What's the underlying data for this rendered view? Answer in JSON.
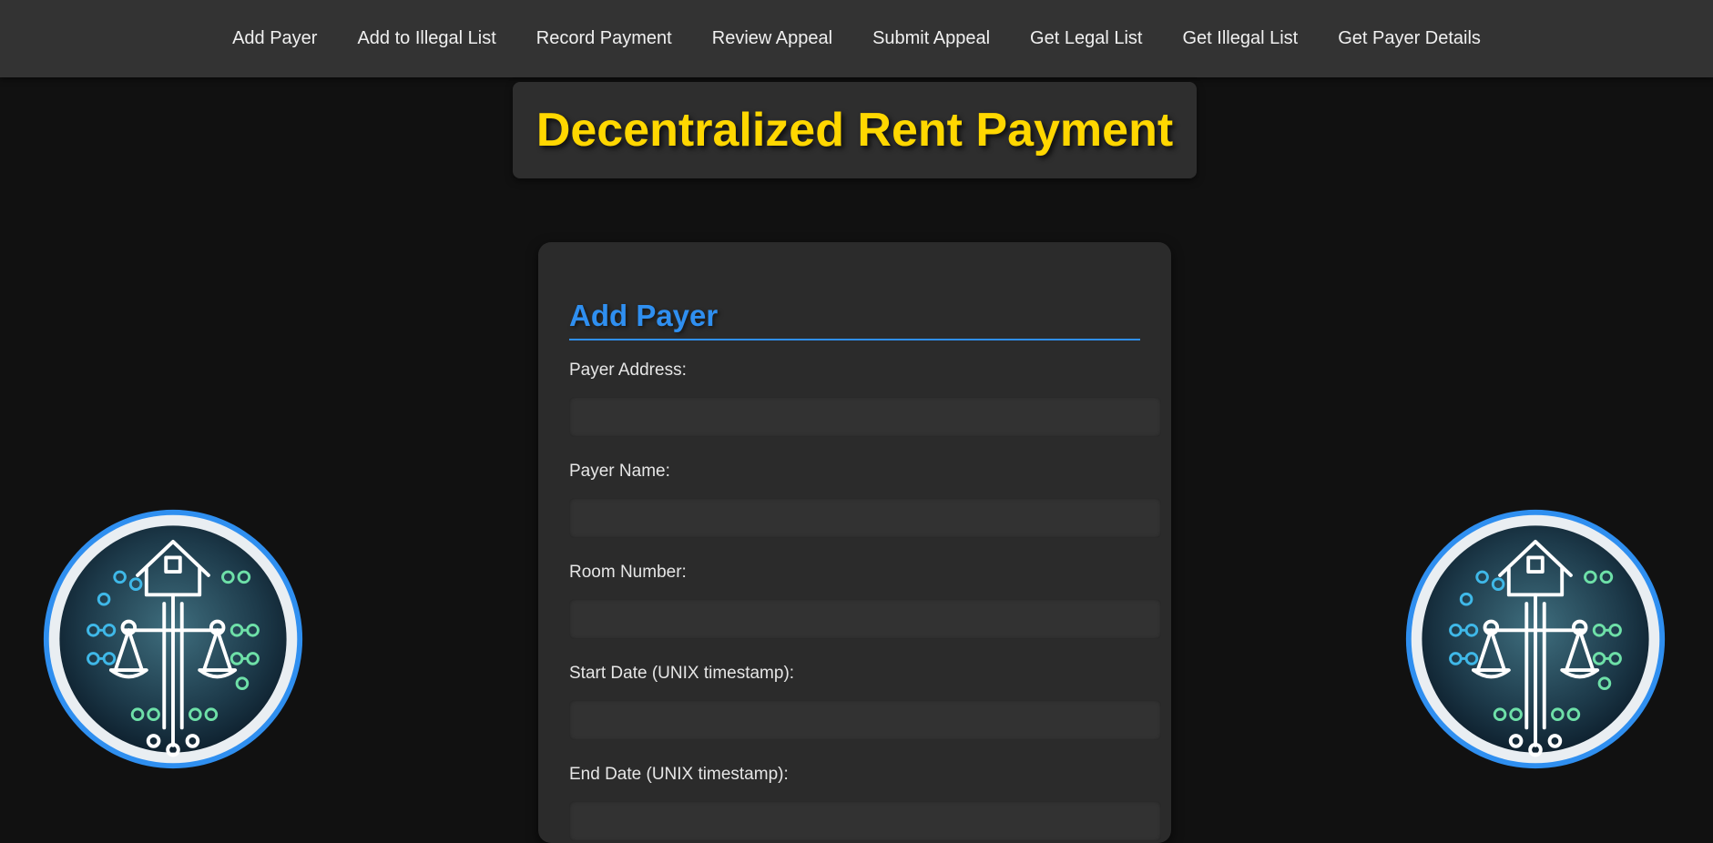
{
  "nav": {
    "items": [
      {
        "label": "Add Payer"
      },
      {
        "label": "Add to Illegal List"
      },
      {
        "label": "Record Payment"
      },
      {
        "label": "Review Appeal"
      },
      {
        "label": "Submit Appeal"
      },
      {
        "label": "Get Legal List"
      },
      {
        "label": "Get Illegal List"
      },
      {
        "label": "Get Payer Details"
      }
    ]
  },
  "header": {
    "title": "Decentralized Rent Payment"
  },
  "form": {
    "heading": "Add Payer",
    "fields": [
      {
        "label": "Payer Address:",
        "value": ""
      },
      {
        "label": "Payer Name:",
        "value": ""
      },
      {
        "label": "Room Number:",
        "value": ""
      },
      {
        "label": "Start Date (UNIX timestamp):",
        "value": ""
      },
      {
        "label": "End Date (UNIX timestamp):",
        "value": ""
      }
    ]
  },
  "logos": {
    "icon": "house-scales-circuit-logo"
  },
  "colors": {
    "accent": "#2f8ff0",
    "title": "#ffd700",
    "background": "#111111",
    "navbar": "#333333",
    "card": "#2b2b2b"
  }
}
